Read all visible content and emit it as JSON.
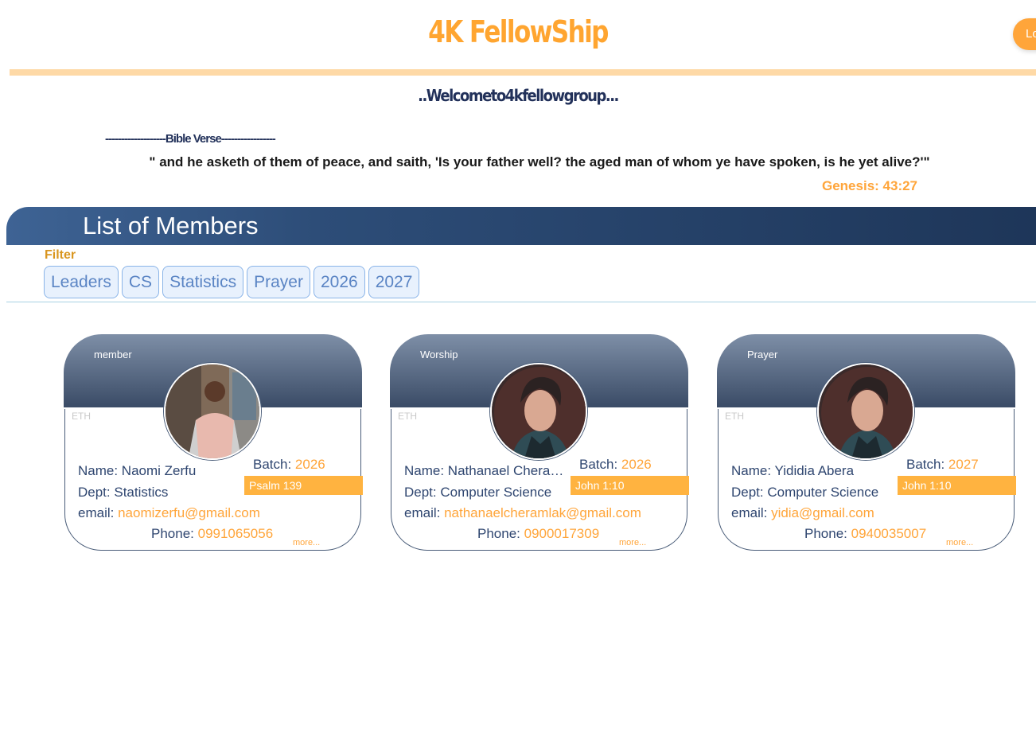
{
  "header": {
    "brand": "4K FellowShip",
    "login_label": "Login",
    "welcome": "..Welcometo4kfellowgroup..."
  },
  "verse": {
    "heading": "-------------------Bible Verse-----------------",
    "text": "\" and he asketh of them of peace, and saith, 'Is your father well? the aged man of whom ye have spoken, is he yet alive?'\"",
    "reference": "Genesis: 43:27"
  },
  "members": {
    "title": "List of Members",
    "filter_label": "Filter",
    "filters": [
      "Leaders",
      "CS",
      "Statistics",
      "Prayer",
      "2026",
      "2027"
    ]
  },
  "card_labels": {
    "name": "Name: ",
    "dept": "Dept: ",
    "email": "email: ",
    "phone": "Phone: ",
    "batch": "Batch: ",
    "country": "ETH",
    "more": "more..."
  },
  "cards": [
    {
      "role": "member",
      "name": "Naomi Zerfu",
      "dept": "Statistics",
      "email": "naomizerfu@gmail.com",
      "phone": "0991065056",
      "batch": "2026",
      "verse": "Psalm 139"
    },
    {
      "role": "Worship",
      "name": "Nathanael Cheram...",
      "dept": "Computer Science",
      "email": "nathanaelcheramlak@gmail.com",
      "phone": "0900017309",
      "batch": "2026",
      "verse": "John 1:10"
    },
    {
      "role": "Prayer",
      "name": "Yididia Abera",
      "dept": "Computer Science",
      "email": "yidia@gmail.com",
      "phone": "0940035007",
      "batch": "2027",
      "verse": "John 1:10"
    }
  ],
  "colors": {
    "accent": "#ffa53a",
    "navy": "#22315a",
    "band": "#1e3659"
  }
}
